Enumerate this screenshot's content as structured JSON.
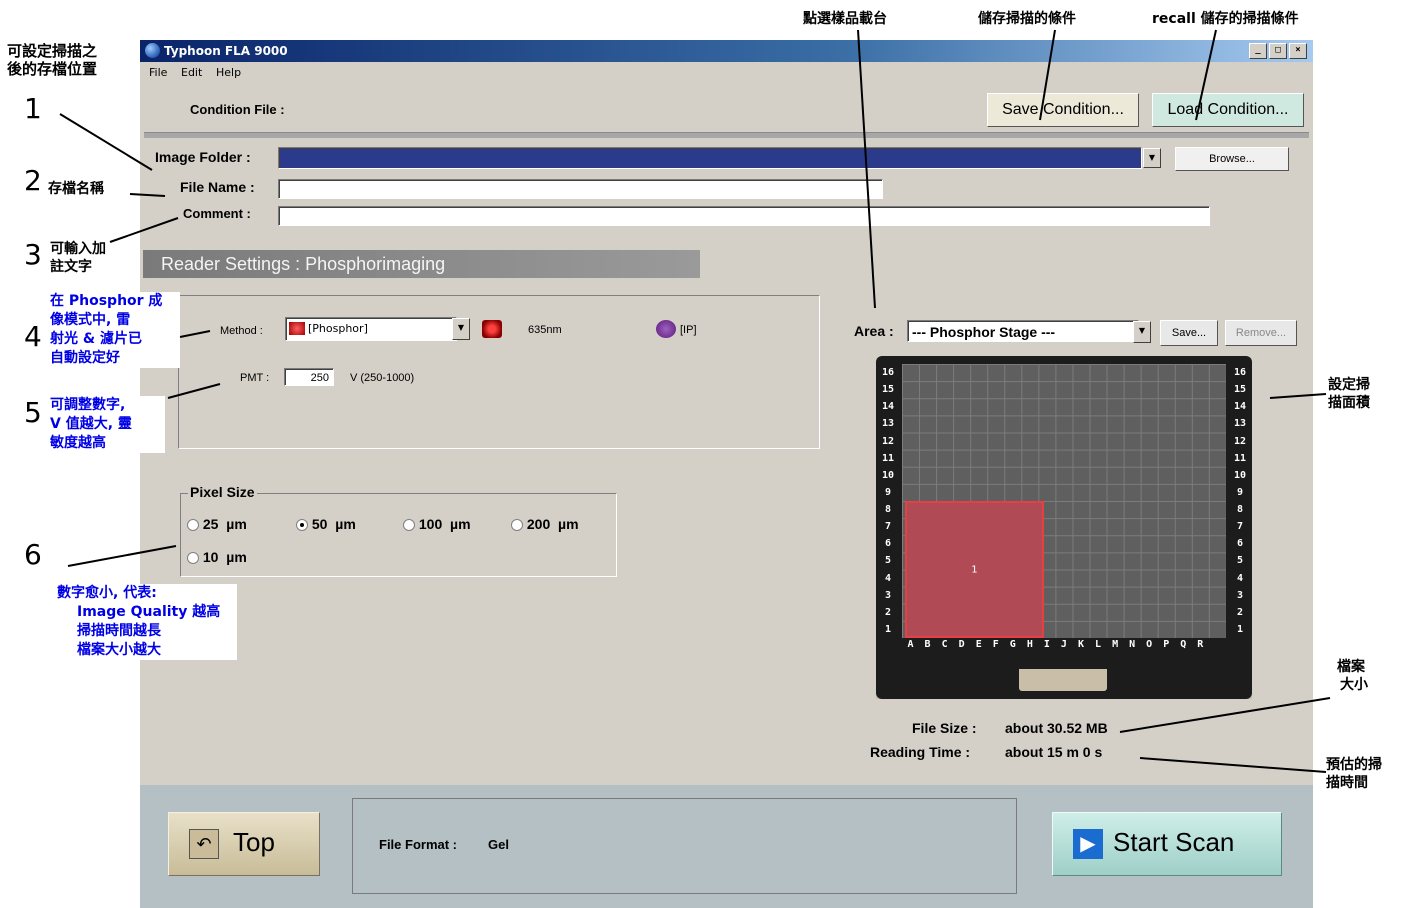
{
  "window": {
    "title": "Typhoon FLA 9000",
    "controls": [
      "_",
      "□",
      "×"
    ],
    "menu": [
      "File",
      "Edit",
      "Help"
    ]
  },
  "condition": {
    "label": "Condition File :",
    "save_button": "Save Condition...",
    "load_button": "Load Condition..."
  },
  "image_folder": {
    "label": "Image Folder :",
    "value": "",
    "browse_button": "Browse..."
  },
  "file_name": {
    "label": "File Name :",
    "value": ""
  },
  "comment": {
    "label": "Comment :",
    "value": ""
  },
  "reader_settings": "Reader Settings : Phosphorimaging",
  "method": {
    "label": "Method :",
    "value": "[Phosphor]",
    "laser": "635nm",
    "filter": "[IP]"
  },
  "pmt": {
    "label": "PMT :",
    "value": "250",
    "range": "V (250-1000)"
  },
  "pixel_size": {
    "label": "Pixel Size",
    "unit": "µm",
    "options": [
      {
        "value": "25",
        "selected": false
      },
      {
        "value": "50",
        "selected": true
      },
      {
        "value": "100",
        "selected": false
      },
      {
        "value": "200",
        "selected": false
      },
      {
        "value": "10",
        "selected": false
      }
    ]
  },
  "area": {
    "label": "Area :",
    "value": "--- Phosphor Stage ---",
    "save_button": "Save...",
    "remove_button": "Remove...",
    "rows": [
      "16",
      "15",
      "14",
      "13",
      "12",
      "11",
      "10",
      "9",
      "8",
      "7",
      "6",
      "5",
      "4",
      "3",
      "2",
      "1"
    ],
    "columns": [
      "A",
      "B",
      "C",
      "D",
      "E",
      "F",
      "G",
      "H",
      "I",
      "J",
      "K",
      "L",
      "M",
      "N",
      "O",
      "P",
      "Q",
      "R"
    ],
    "selection_label": "1",
    "selection_color": "#b04a55"
  },
  "file_size": {
    "label": "File Size :",
    "value": "about 30.52 MB"
  },
  "reading_time": {
    "label": "Reading Time :",
    "value": "about 15 m 0 s"
  },
  "bottom": {
    "top_button": "Top",
    "file_format_label": "File Format :",
    "file_format_value": "Gel",
    "start_button": "Start Scan"
  },
  "annotations": {
    "save_location": [
      "可設定掃描之",
      "後的存檔位置"
    ],
    "n1": "1",
    "n2": "2",
    "file_name_note": "存檔名稱",
    "n3": "3",
    "comment_note": [
      "可輸入加",
      "註文字"
    ],
    "n4": "4",
    "method_note": [
      "在 Phosphor 成",
      "像模式中, 雷",
      "射光 & 濾片已",
      "自動設定好"
    ],
    "n5": "5",
    "pmt_note": [
      "可調整數字,",
      "V 值越大, 靈",
      "敏度越高"
    ],
    "n6": "6",
    "pixel_note": [
      "數字愈小, 代表:",
      "Image Quality 越高",
      "掃描時間越長",
      "檔案大小越大"
    ],
    "stage_select": "點選樣品載台",
    "save_cond_note": "儲存掃描的條件",
    "recall_note": "recall 儲存的掃描條件",
    "area_note": [
      "設定掃",
      "描面積"
    ],
    "file_size_note": [
      "檔案",
      "大小"
    ],
    "time_note": [
      "預估的掃",
      "描時間"
    ]
  }
}
